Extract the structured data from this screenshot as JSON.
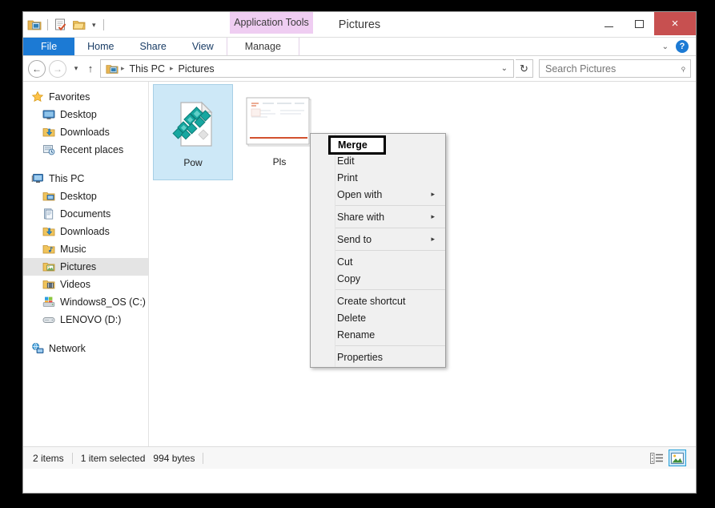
{
  "window": {
    "title": "Pictures",
    "contextual_tab_header": "Application Tools",
    "controls": {
      "minimize": "–",
      "maximize": "□",
      "close": "×"
    }
  },
  "quick_access_toolbar": {
    "items": [
      {
        "name": "folder-properties-icon",
        "label": ""
      },
      {
        "name": "properties-icon",
        "label": ""
      },
      {
        "name": "new-folder-icon",
        "label": ""
      }
    ],
    "caret": "▾"
  },
  "ribbon": {
    "tabs": [
      {
        "label": "File",
        "id": "file",
        "active": true
      },
      {
        "label": "Home",
        "id": "home",
        "active": false
      },
      {
        "label": "Share",
        "id": "share",
        "active": false
      },
      {
        "label": "View",
        "id": "view",
        "active": false
      },
      {
        "label": "Manage",
        "id": "manage",
        "active": false
      }
    ],
    "collapse_caret": "⌄",
    "help_label": "?"
  },
  "address_bar": {
    "back": "←",
    "forward": "→",
    "history_caret": "▾",
    "up": "↑",
    "breadcrumbs": [
      {
        "label": "This PC"
      },
      {
        "label": "Pictures"
      }
    ],
    "separator": "▸",
    "dropdown_caret": "⌄",
    "refresh": "↻"
  },
  "search": {
    "placeholder": "Search Pictures",
    "value": "",
    "icon": "⌕"
  },
  "sidebar": {
    "groups": [
      {
        "header": {
          "label": "Favorites",
          "icon": "star-icon"
        },
        "items": [
          {
            "label": "Desktop",
            "icon": "desktop-icon"
          },
          {
            "label": "Downloads",
            "icon": "downloads-icon"
          },
          {
            "label": "Recent places",
            "icon": "recent-places-icon"
          }
        ]
      },
      {
        "header": {
          "label": "This PC",
          "icon": "this-pc-icon"
        },
        "items": [
          {
            "label": "Desktop",
            "icon": "desktop-folder-icon"
          },
          {
            "label": "Documents",
            "icon": "documents-icon"
          },
          {
            "label": "Downloads",
            "icon": "downloads-icon"
          },
          {
            "label": "Music",
            "icon": "music-icon"
          },
          {
            "label": "Pictures",
            "icon": "pictures-icon",
            "selected": true
          },
          {
            "label": "Videos",
            "icon": "videos-icon"
          },
          {
            "label": "Windows8_OS (C:)",
            "icon": "system-drive-icon"
          },
          {
            "label": "LENOVO (D:)",
            "icon": "drive-icon"
          }
        ]
      },
      {
        "header": {
          "label": "Network",
          "icon": "network-icon"
        },
        "items": []
      }
    ]
  },
  "files": [
    {
      "label": "Pow",
      "icon": "presentation-file-icon",
      "selected": true
    },
    {
      "label": "Pls",
      "icon": "document-file-icon",
      "selected": false
    }
  ],
  "context_menu": {
    "focused_item": "Merge",
    "sections": [
      {
        "items": [
          {
            "label": "Merge",
            "bold": true,
            "submenu": false,
            "focused": true
          },
          {
            "label": "Edit",
            "bold": false,
            "submenu": false
          },
          {
            "label": "Print",
            "bold": false,
            "submenu": false
          },
          {
            "label": "Open with",
            "bold": false,
            "submenu": true
          }
        ]
      },
      {
        "items": [
          {
            "label": "Share with",
            "bold": false,
            "submenu": true
          }
        ]
      },
      {
        "items": [
          {
            "label": "Send to",
            "bold": false,
            "submenu": true
          }
        ]
      },
      {
        "items": [
          {
            "label": "Cut",
            "bold": false,
            "submenu": false
          },
          {
            "label": "Copy",
            "bold": false,
            "submenu": false
          }
        ]
      },
      {
        "items": [
          {
            "label": "Create shortcut",
            "bold": false,
            "submenu": false
          },
          {
            "label": "Delete",
            "bold": false,
            "submenu": false
          },
          {
            "label": "Rename",
            "bold": false,
            "submenu": false
          }
        ]
      },
      {
        "items": [
          {
            "label": "Properties",
            "bold": false,
            "submenu": false
          }
        ]
      }
    ],
    "submenu_arrow": "▸"
  },
  "status_bar": {
    "item_count": "2 items",
    "selection": "1 item selected",
    "size": "994 bytes",
    "views": [
      {
        "name": "details-view-button",
        "active": false
      },
      {
        "name": "large-icons-view-button",
        "active": true
      }
    ]
  },
  "colors": {
    "accent": "#1c7ad4",
    "close_button": "#c75050",
    "contextual_tab": "#efcdf2",
    "selection": "#cde8f7",
    "menu_bg": "#f0f0f0"
  }
}
